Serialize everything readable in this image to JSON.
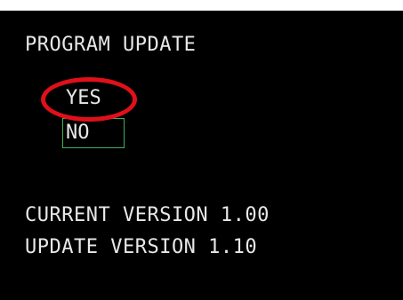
{
  "screen": {
    "title": "PROGRAM UPDATE",
    "options": [
      {
        "label": "YES"
      },
      {
        "label": "NO"
      }
    ],
    "current_version": "CURRENT VERSION 1.00",
    "update_version": "UPDATE VERSION 1.10"
  },
  "colors": {
    "background": "#000000",
    "text": "#e8e8e8",
    "selection_border": "#3fae5a",
    "annotation": "#e0101a"
  }
}
